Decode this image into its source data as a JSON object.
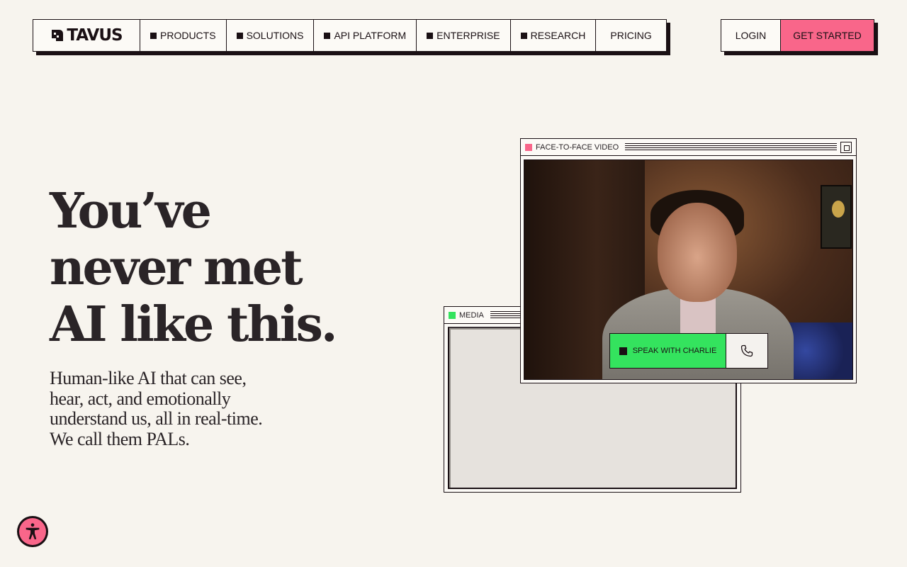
{
  "brand": {
    "name": "TAVUS"
  },
  "nav": {
    "items": [
      {
        "label": "PRODUCTS",
        "has_square": true
      },
      {
        "label": "SOLUTIONS",
        "has_square": true
      },
      {
        "label": "API PLATFORM",
        "has_square": true
      },
      {
        "label": "ENTERPRISE",
        "has_square": true
      },
      {
        "label": "RESEARCH",
        "has_square": true
      },
      {
        "label": "PRICING",
        "has_square": false
      }
    ],
    "login_label": "LOGIN",
    "get_started_label": "GET STARTED"
  },
  "hero": {
    "headline_lines": [
      "You’ve",
      "never met",
      "AI like this."
    ],
    "subtext": "Human-like AI that can see, hear, act, and emotionally understand us, all in real-time. We call them PALs."
  },
  "windows": {
    "video": {
      "title": "FACE-TO-FACE VIDEO",
      "indicator_color": "#f9668a"
    },
    "media": {
      "title": "MEDIA",
      "indicator_color": "#34e35e"
    }
  },
  "call": {
    "speak_label": "SPEAK WITH CHARLIE",
    "call_icon": "phone-icon"
  },
  "accessibility": {
    "icon": "accessibility-icon"
  },
  "colors": {
    "accent_pink": "#f9668a",
    "accent_green": "#34e35e",
    "background": "#f7f4ee",
    "ink": "#1a1014"
  }
}
